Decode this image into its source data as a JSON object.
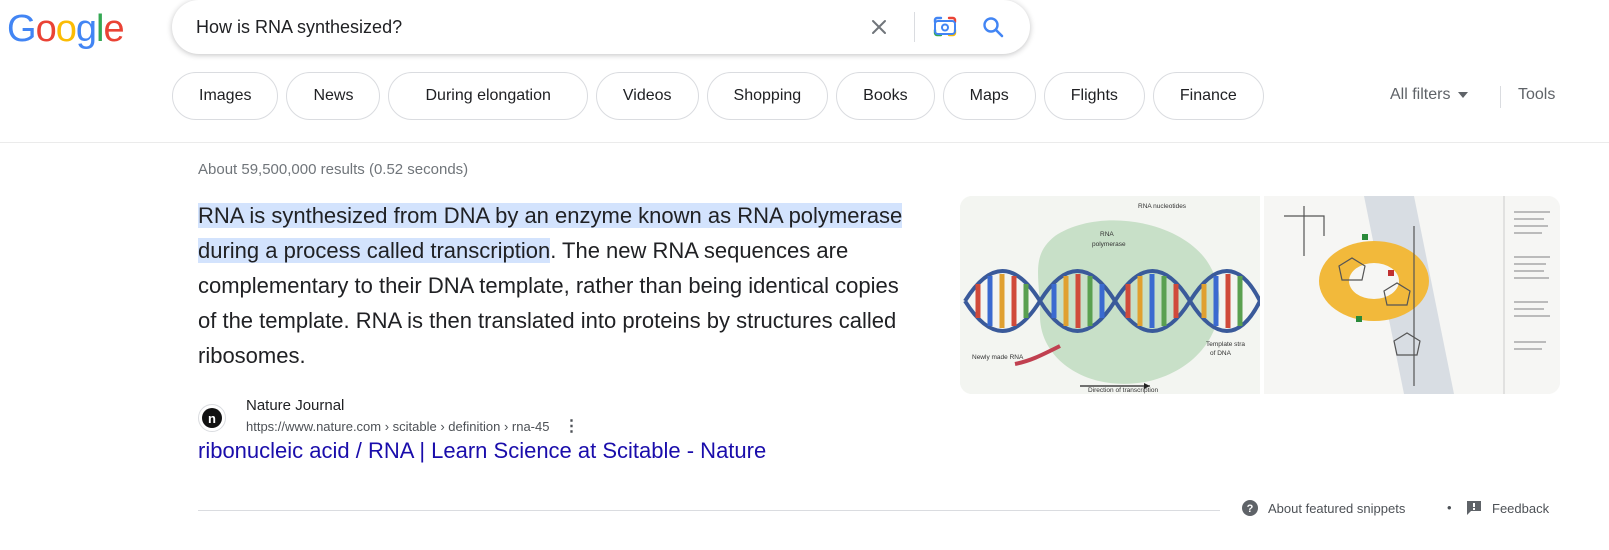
{
  "logo": {
    "letters": [
      "G",
      "o",
      "o",
      "g",
      "l",
      "e"
    ],
    "colors": [
      "#4285F4",
      "#EA4335",
      "#FBBC05",
      "#4285F4",
      "#34A853",
      "#EA4335"
    ]
  },
  "search": {
    "query": "How is RNA synthesized?"
  },
  "chips": [
    "Images",
    "News",
    "During elongation",
    "Videos",
    "Shopping",
    "Books",
    "Maps",
    "Flights",
    "Finance"
  ],
  "filters": {
    "all_filters": "All filters",
    "tools": "Tools"
  },
  "results": {
    "stats": "About 59,500,000 results (0.52 seconds)"
  },
  "snippet": {
    "highlighted": "RNA is synthesized from DNA by an enzyme known as RNA polymerase during a process called transcription",
    "rest": ". The new RNA sequences are complementary to their DNA template, rather than being identical copies of the template. RNA is then translated into proteins by structures called ribosomes."
  },
  "source": {
    "favicon_letter": "n",
    "name": "Nature Journal",
    "url": "https://www.nature.com › scitable › definition › rna-45",
    "title": "ribonucleic acid / RNA | Learn Science at Scitable - Nature"
  },
  "diagram": {
    "labels": {
      "rna_nucleotides": "RNA nucleotides",
      "rna_polymerase_1": "RNA",
      "rna_polymerase_2": "polymerase",
      "template_1": "Template stra",
      "template_2": "of DNA",
      "newly_made": "Newly made RNA",
      "direction": "Direction of transcription"
    }
  },
  "footer": {
    "about": "About featured snippets",
    "separator": "•",
    "feedback": "Feedback"
  },
  "colors": {
    "link": "#1a0dab",
    "highlight": "#d3e3fd",
    "accent": "#1a73e8"
  }
}
